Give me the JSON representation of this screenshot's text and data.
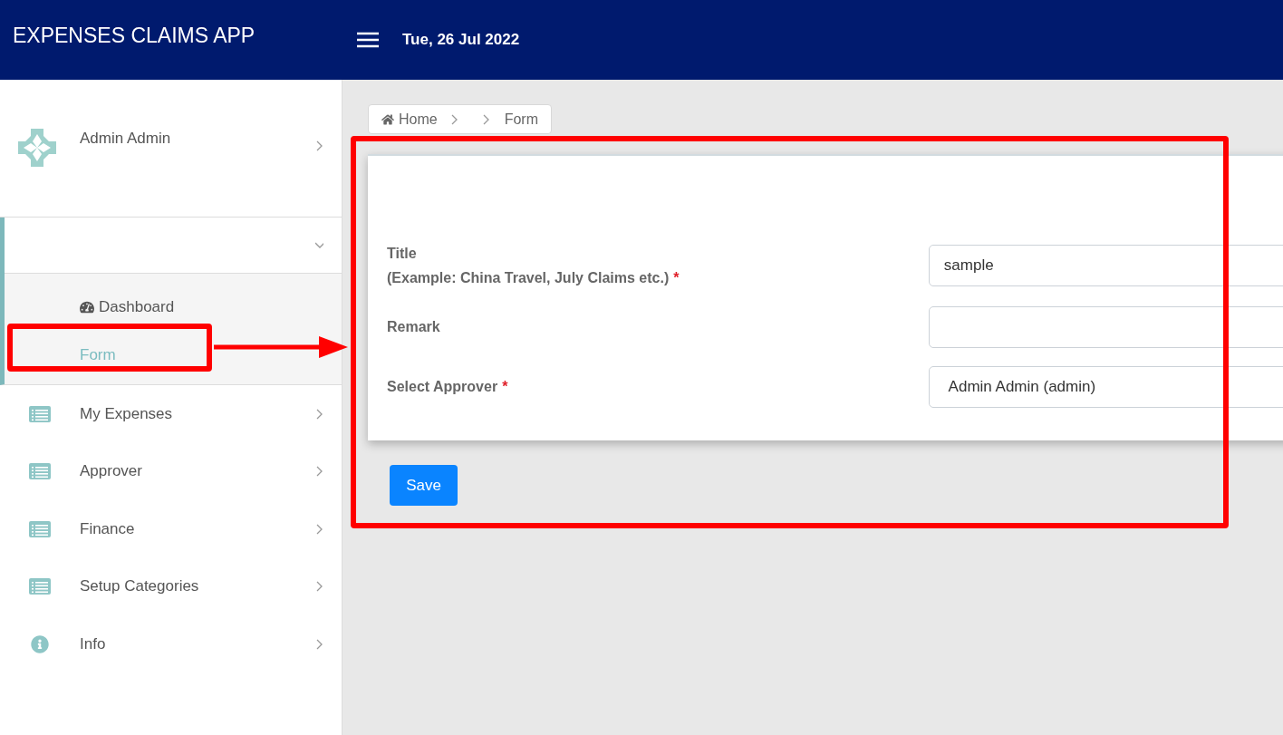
{
  "header": {
    "title": "EXPENSES CLAIMS APP",
    "date": "Tue, 26 Jul 2022"
  },
  "sidebar": {
    "profile": {
      "name": "Admin Admin"
    },
    "group": {
      "expanded": true,
      "items": [
        {
          "label": "Dashboard",
          "selected": false
        },
        {
          "label": "Form",
          "selected": true
        }
      ]
    },
    "items": [
      {
        "label": "My Expenses",
        "kind": "list"
      },
      {
        "label": "Approver",
        "kind": "list"
      },
      {
        "label": "Finance",
        "kind": "list"
      },
      {
        "label": "Setup Categories",
        "kind": "list"
      },
      {
        "label": "Info",
        "kind": "info"
      }
    ]
  },
  "breadcrumb": [
    "Home",
    "Form"
  ],
  "form": {
    "fields": [
      {
        "kind": "text",
        "label": "Title",
        "hint": "(Example: China Travel, July Claims etc.)",
        "required_mark": "*",
        "value": "sample"
      },
      {
        "kind": "text",
        "label": "Remark"
      },
      {
        "kind": "select",
        "label": "Select Approver",
        "required_mark": "*",
        "value": "Admin Admin (admin)"
      }
    ],
    "button": "Save"
  },
  "annotations": [
    {
      "kind": "box"
    },
    {
      "kind": "arrow"
    },
    {
      "kind": "box"
    }
  ]
}
